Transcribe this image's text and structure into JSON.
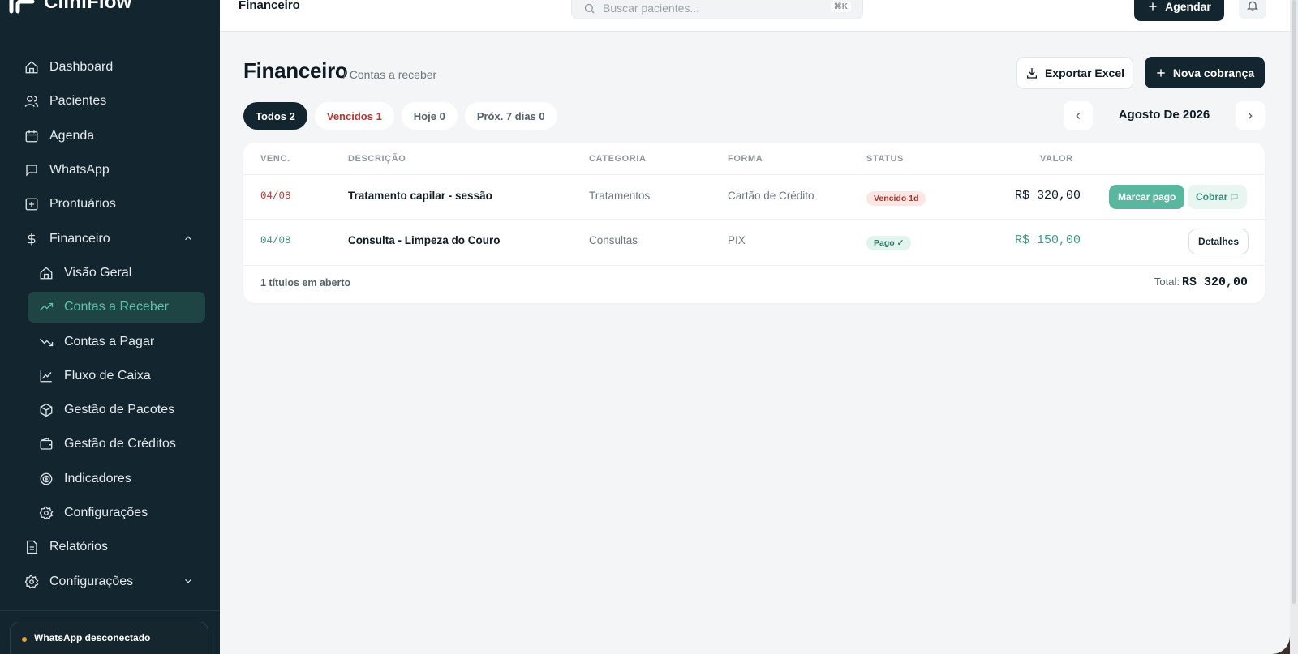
{
  "app": {
    "name": "CliniFlow"
  },
  "sidebar": {
    "items": [
      {
        "label": "Dashboard"
      },
      {
        "label": "Pacientes"
      },
      {
        "label": "Agenda"
      },
      {
        "label": "WhatsApp"
      },
      {
        "label": "Prontuários"
      },
      {
        "label": "Financeiro"
      },
      {
        "label": "Relatórios"
      },
      {
        "label": "Configurações"
      }
    ],
    "financeiro_sub": [
      {
        "label": "Visão Geral"
      },
      {
        "label": "Contas a Receber"
      },
      {
        "label": "Contas a Pagar"
      },
      {
        "label": "Fluxo de Caixa"
      },
      {
        "label": "Gestão de Pacotes"
      },
      {
        "label": "Gestão de Créditos"
      },
      {
        "label": "Indicadores"
      },
      {
        "label": "Configurações"
      }
    ],
    "whatsapp_status": "WhatsApp desconectado"
  },
  "topbar": {
    "title": "Financeiro",
    "search_placeholder": "Buscar pacientes...",
    "search_shortcut": "⌘K",
    "agendar_label": "Agendar"
  },
  "page": {
    "title": "Financeiro",
    "breadcrumb": "/ Contas a receber",
    "export_label": "Exportar Excel",
    "new_label": "Nova cobrança"
  },
  "filters": [
    {
      "label": "Todos 2"
    },
    {
      "label": "Vencidos 1"
    },
    {
      "label": "Hoje 0"
    },
    {
      "label": "Próx. 7 dias 0"
    }
  ],
  "month": {
    "label": "Agosto De 2026"
  },
  "table": {
    "headers": [
      "VENC.",
      "DESCRIÇÃO",
      "CATEGORIA",
      "FORMA",
      "STATUS",
      "VALOR"
    ],
    "rows": [
      {
        "venc": "04/08",
        "descricao": "Tratamento capilar - sessão",
        "categoria": "Tratamentos",
        "forma": "Cartão de Crédito",
        "status": "Vencido 1d",
        "valor": "R$ 320,00",
        "action_primary": "Marcar pago",
        "action_secondary": "Cobrar"
      },
      {
        "venc": "04/08",
        "descricao": "Consulta - Limpeza do Couro",
        "categoria": "Consultas",
        "forma": "PIX",
        "status": "Pago ✓",
        "valor": "R$ 150,00",
        "action": "Detalhes"
      }
    ],
    "footer_count": "1 títulos em aberto",
    "total_label": "Total:",
    "total_value": "R$ 320,00"
  },
  "colors": {
    "sidebar_bg": "#13252f",
    "accent": "#5ab79f",
    "danger": "#b23b32",
    "dark_button": "#13252f"
  }
}
